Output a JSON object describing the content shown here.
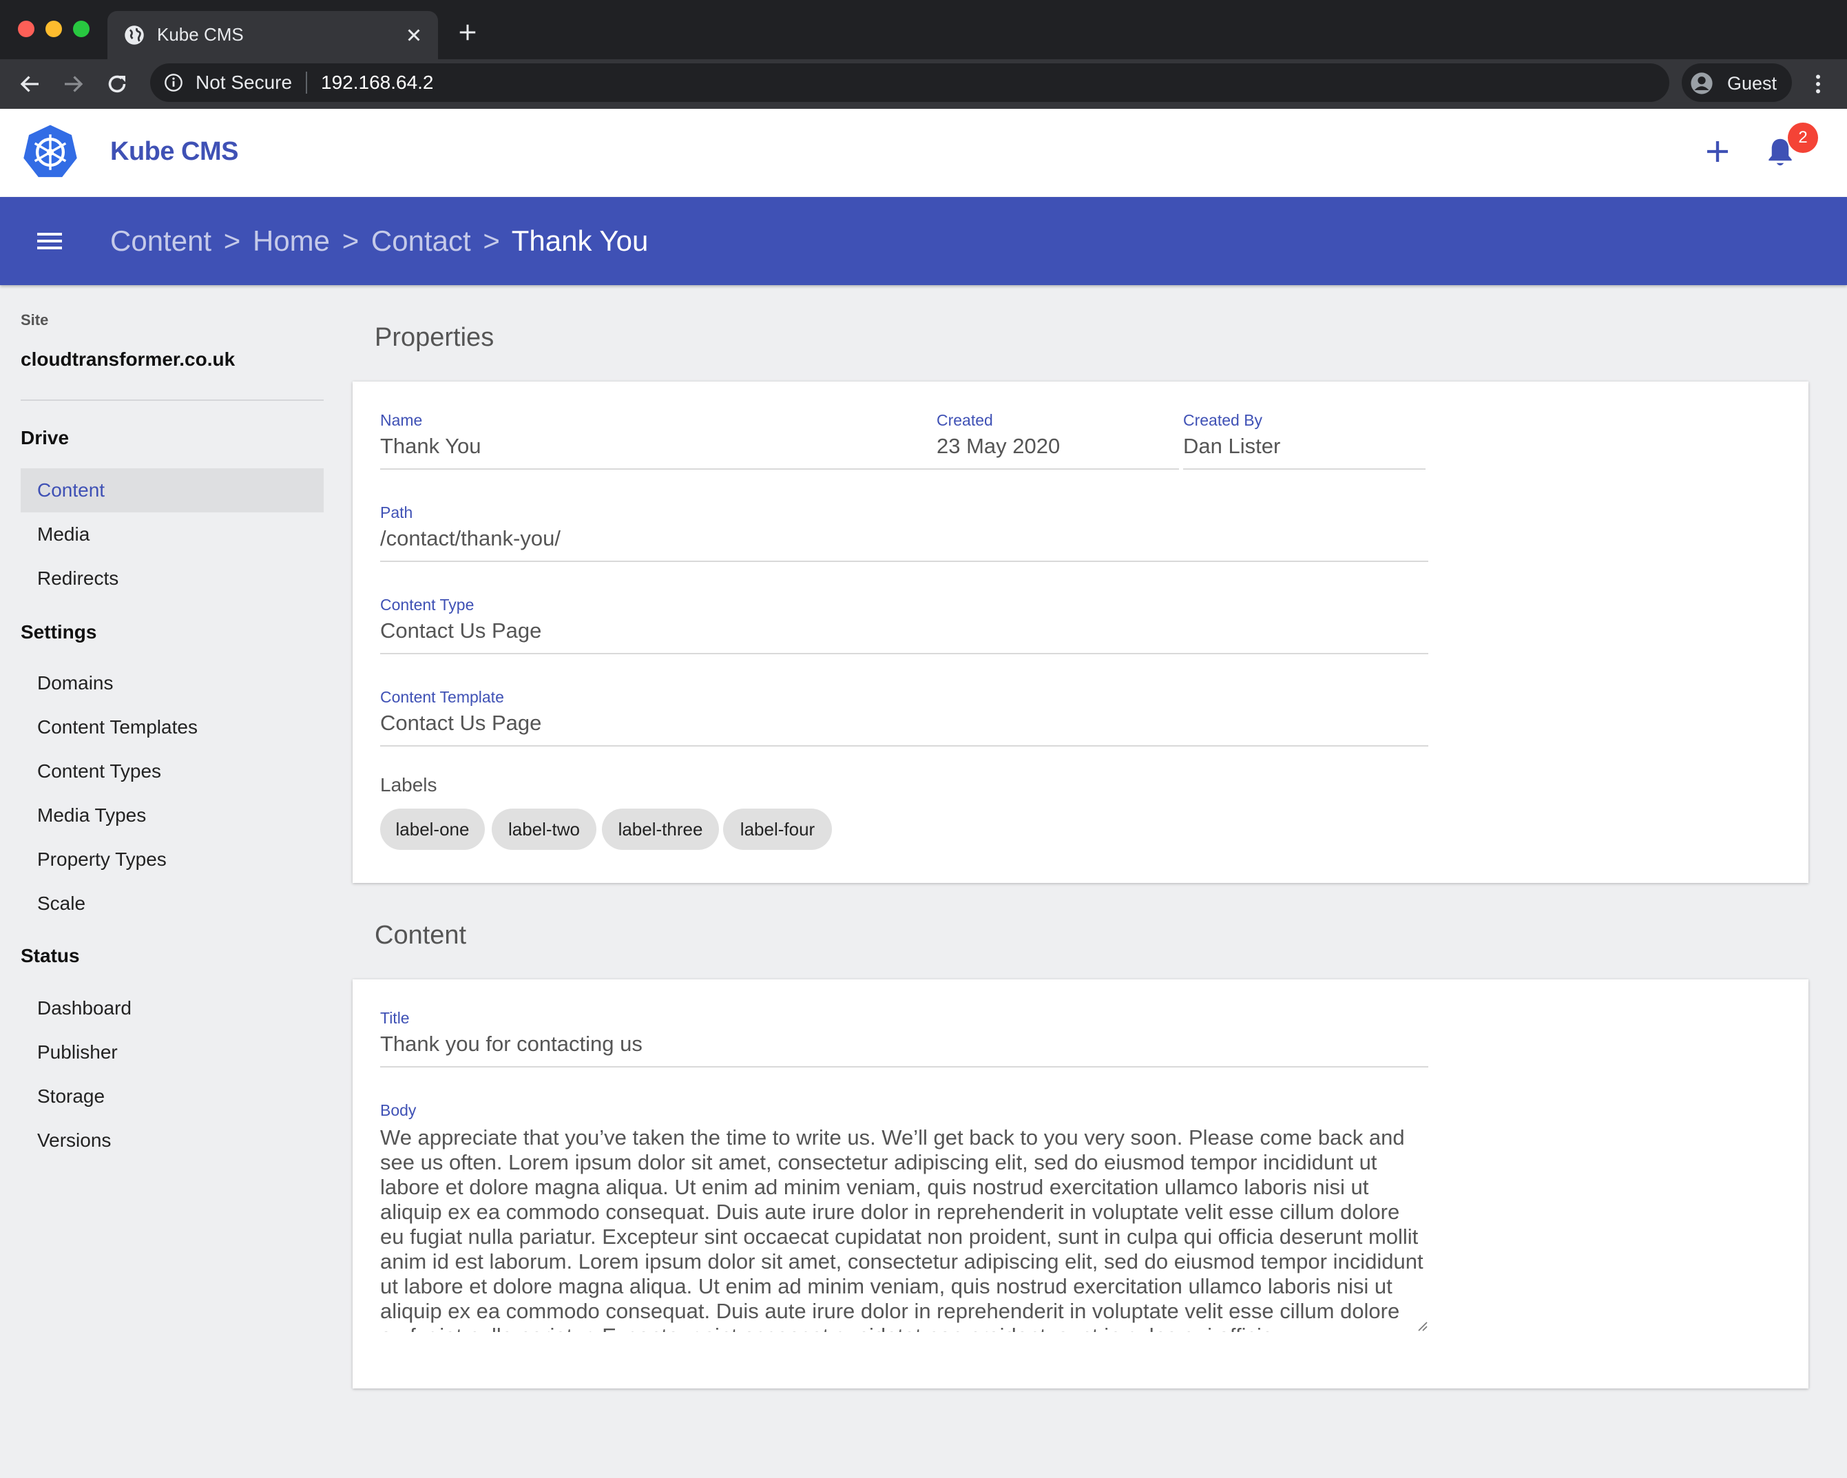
{
  "browser": {
    "tab_title": "Kube CMS",
    "security_label": "Not Secure",
    "url": "192.168.64.2",
    "profile_name": "Guest"
  },
  "app": {
    "title": "Kube CMS",
    "notification_count": "2",
    "brand_color": "#3f51b5"
  },
  "breadcrumb": {
    "items": [
      "Content",
      "Home",
      "Contact"
    ],
    "separator": ">",
    "current": "Thank You"
  },
  "sidebar": {
    "site_label": "Site",
    "site_name": "cloudtransformer.co.uk",
    "sections": [
      {
        "title": "Drive",
        "items": [
          "Content",
          "Media",
          "Redirects"
        ]
      },
      {
        "title": "Settings",
        "items": [
          "Domains",
          "Content Templates",
          "Content Types",
          "Media Types",
          "Property Types",
          "Scale"
        ]
      },
      {
        "title": "Status",
        "items": [
          "Dashboard",
          "Publisher",
          "Storage",
          "Versions"
        ]
      }
    ],
    "active_item": "Content"
  },
  "properties": {
    "section_title": "Properties",
    "name": {
      "label": "Name",
      "value": "Thank You"
    },
    "created": {
      "label": "Created",
      "value": "23 May 2020"
    },
    "created_by": {
      "label": "Created By",
      "value": "Dan Lister"
    },
    "path": {
      "label": "Path",
      "value": "/contact/thank-you/"
    },
    "content_type": {
      "label": "Content Type",
      "value": "Contact Us Page"
    },
    "content_template": {
      "label": "Content Template",
      "value": "Contact Us Page"
    },
    "labels_title": "Labels",
    "labels": [
      "label-one",
      "label-two",
      "label-three",
      "label-four"
    ]
  },
  "content": {
    "section_title": "Content",
    "title": {
      "label": "Title",
      "value": "Thank you for contacting us"
    },
    "body": {
      "label": "Body",
      "value": "We appreciate that you’ve taken the time to write us. We’ll get back to you very soon. Please come back and see us often. Lorem ipsum dolor sit amet, consectetur adipiscing elit, sed do eiusmod tempor incididunt ut labore et dolore magna aliqua. Ut enim ad minim veniam, quis nostrud exercitation ullamco laboris nisi ut aliquip ex ea commodo consequat. Duis aute irure dolor in reprehenderit in voluptate velit esse cillum dolore eu fugiat nulla pariatur. Excepteur sint occaecat cupidatat non proident, sunt in culpa qui officia deserunt mollit anim id est laborum. Lorem ipsum dolor sit amet, consectetur adipiscing elit, sed do eiusmod tempor incididunt ut labore et dolore magna aliqua. Ut enim ad minim veniam, quis nostrud exercitation ullamco laboris nisi ut aliquip ex ea commodo consequat. Duis aute irure dolor in reprehenderit in voluptate velit esse cillum dolore eu fugiat nulla pariatur. Excepteur sint occaecat cupidatat non proident, sunt in culpa qui officia"
    }
  }
}
